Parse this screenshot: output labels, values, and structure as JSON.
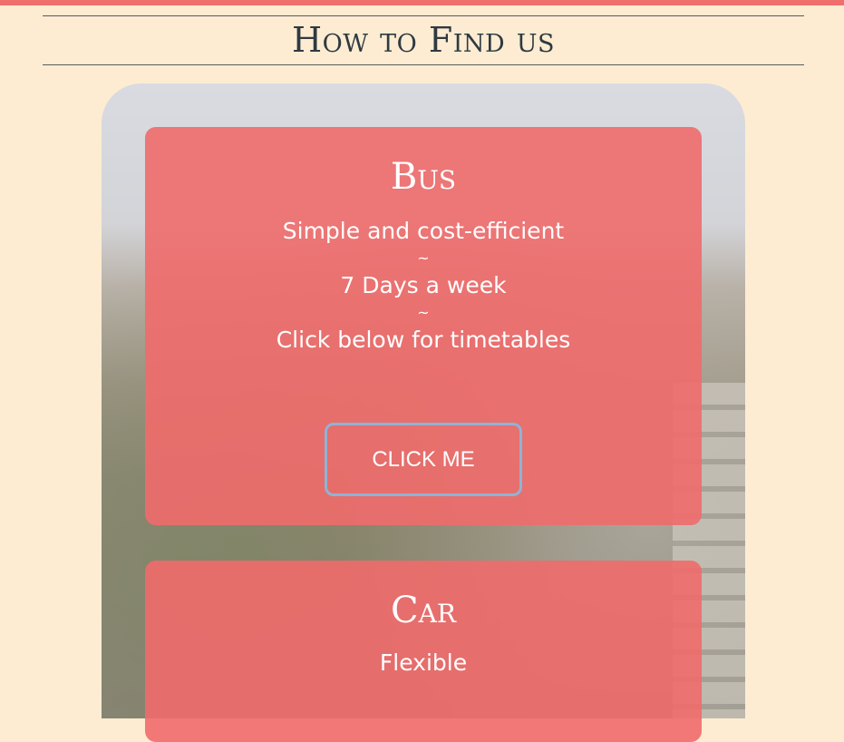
{
  "page": {
    "heading": "How to Find us"
  },
  "cards": {
    "bus": {
      "title": "Bus",
      "line1": "Simple and cost-efficient",
      "sep1": "~",
      "line2": "7 Days a week",
      "sep2": "~",
      "line3": "Click below for timetables",
      "button_label": "CLICK ME"
    },
    "car": {
      "title": "Car",
      "line1": "Flexible"
    }
  },
  "colors": {
    "top_bar": "#ef6f6c",
    "background": "#fdecd2",
    "card": "#ef6b6b",
    "button_border": "#8fb3d6",
    "heading_text": "#2f3a40"
  }
}
